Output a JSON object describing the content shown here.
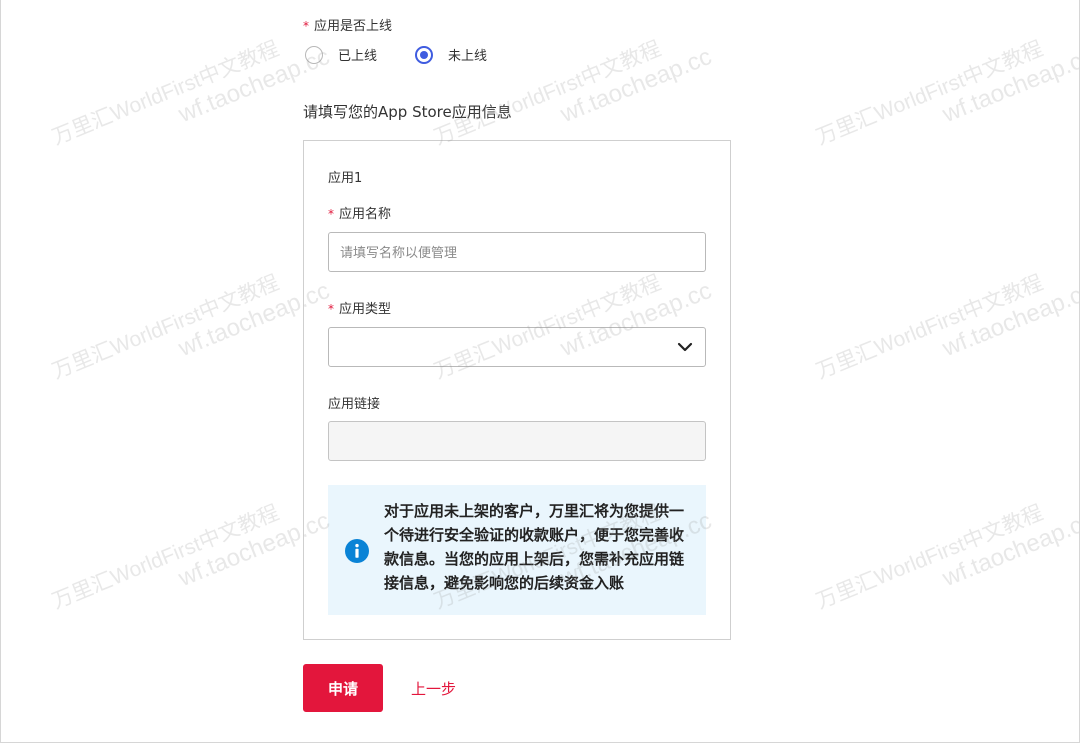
{
  "online_question": {
    "label": "应用是否上线",
    "required": "*",
    "options": [
      {
        "label": "已上线",
        "selected": false
      },
      {
        "label": "未上线",
        "selected": true
      }
    ]
  },
  "section_title": "请填写您的App Store应用信息",
  "app_card": {
    "title": "应用1",
    "name_field": {
      "required": "*",
      "label": "应用名称",
      "placeholder": "请填写名称以便管理",
      "value": ""
    },
    "type_field": {
      "required": "*",
      "label": "应用类型",
      "value": ""
    },
    "link_field": {
      "label": "应用链接",
      "value": ""
    },
    "notice": "对于应用未上架的客户，万里汇将为您提供一个待进行安全验证的收款账户，便于您完善收款信息。当您的应用上架后，您需补充应用链接信息，避免影响您的后续资金入账"
  },
  "actions": {
    "submit_label": "申请",
    "back_label": "上一步"
  },
  "watermark": {
    "line1": "万里汇WorldFirst中文教程",
    "line2": "wf.taocheap.cc"
  },
  "colors": {
    "accent_red": "#e3163c",
    "radio_blue": "#3f5ce0",
    "notice_bg": "#eaf6fd",
    "info_icon": "#0a83d6"
  },
  "icons": {
    "select_arrow": "chevron-down-icon",
    "notice": "info-icon"
  }
}
